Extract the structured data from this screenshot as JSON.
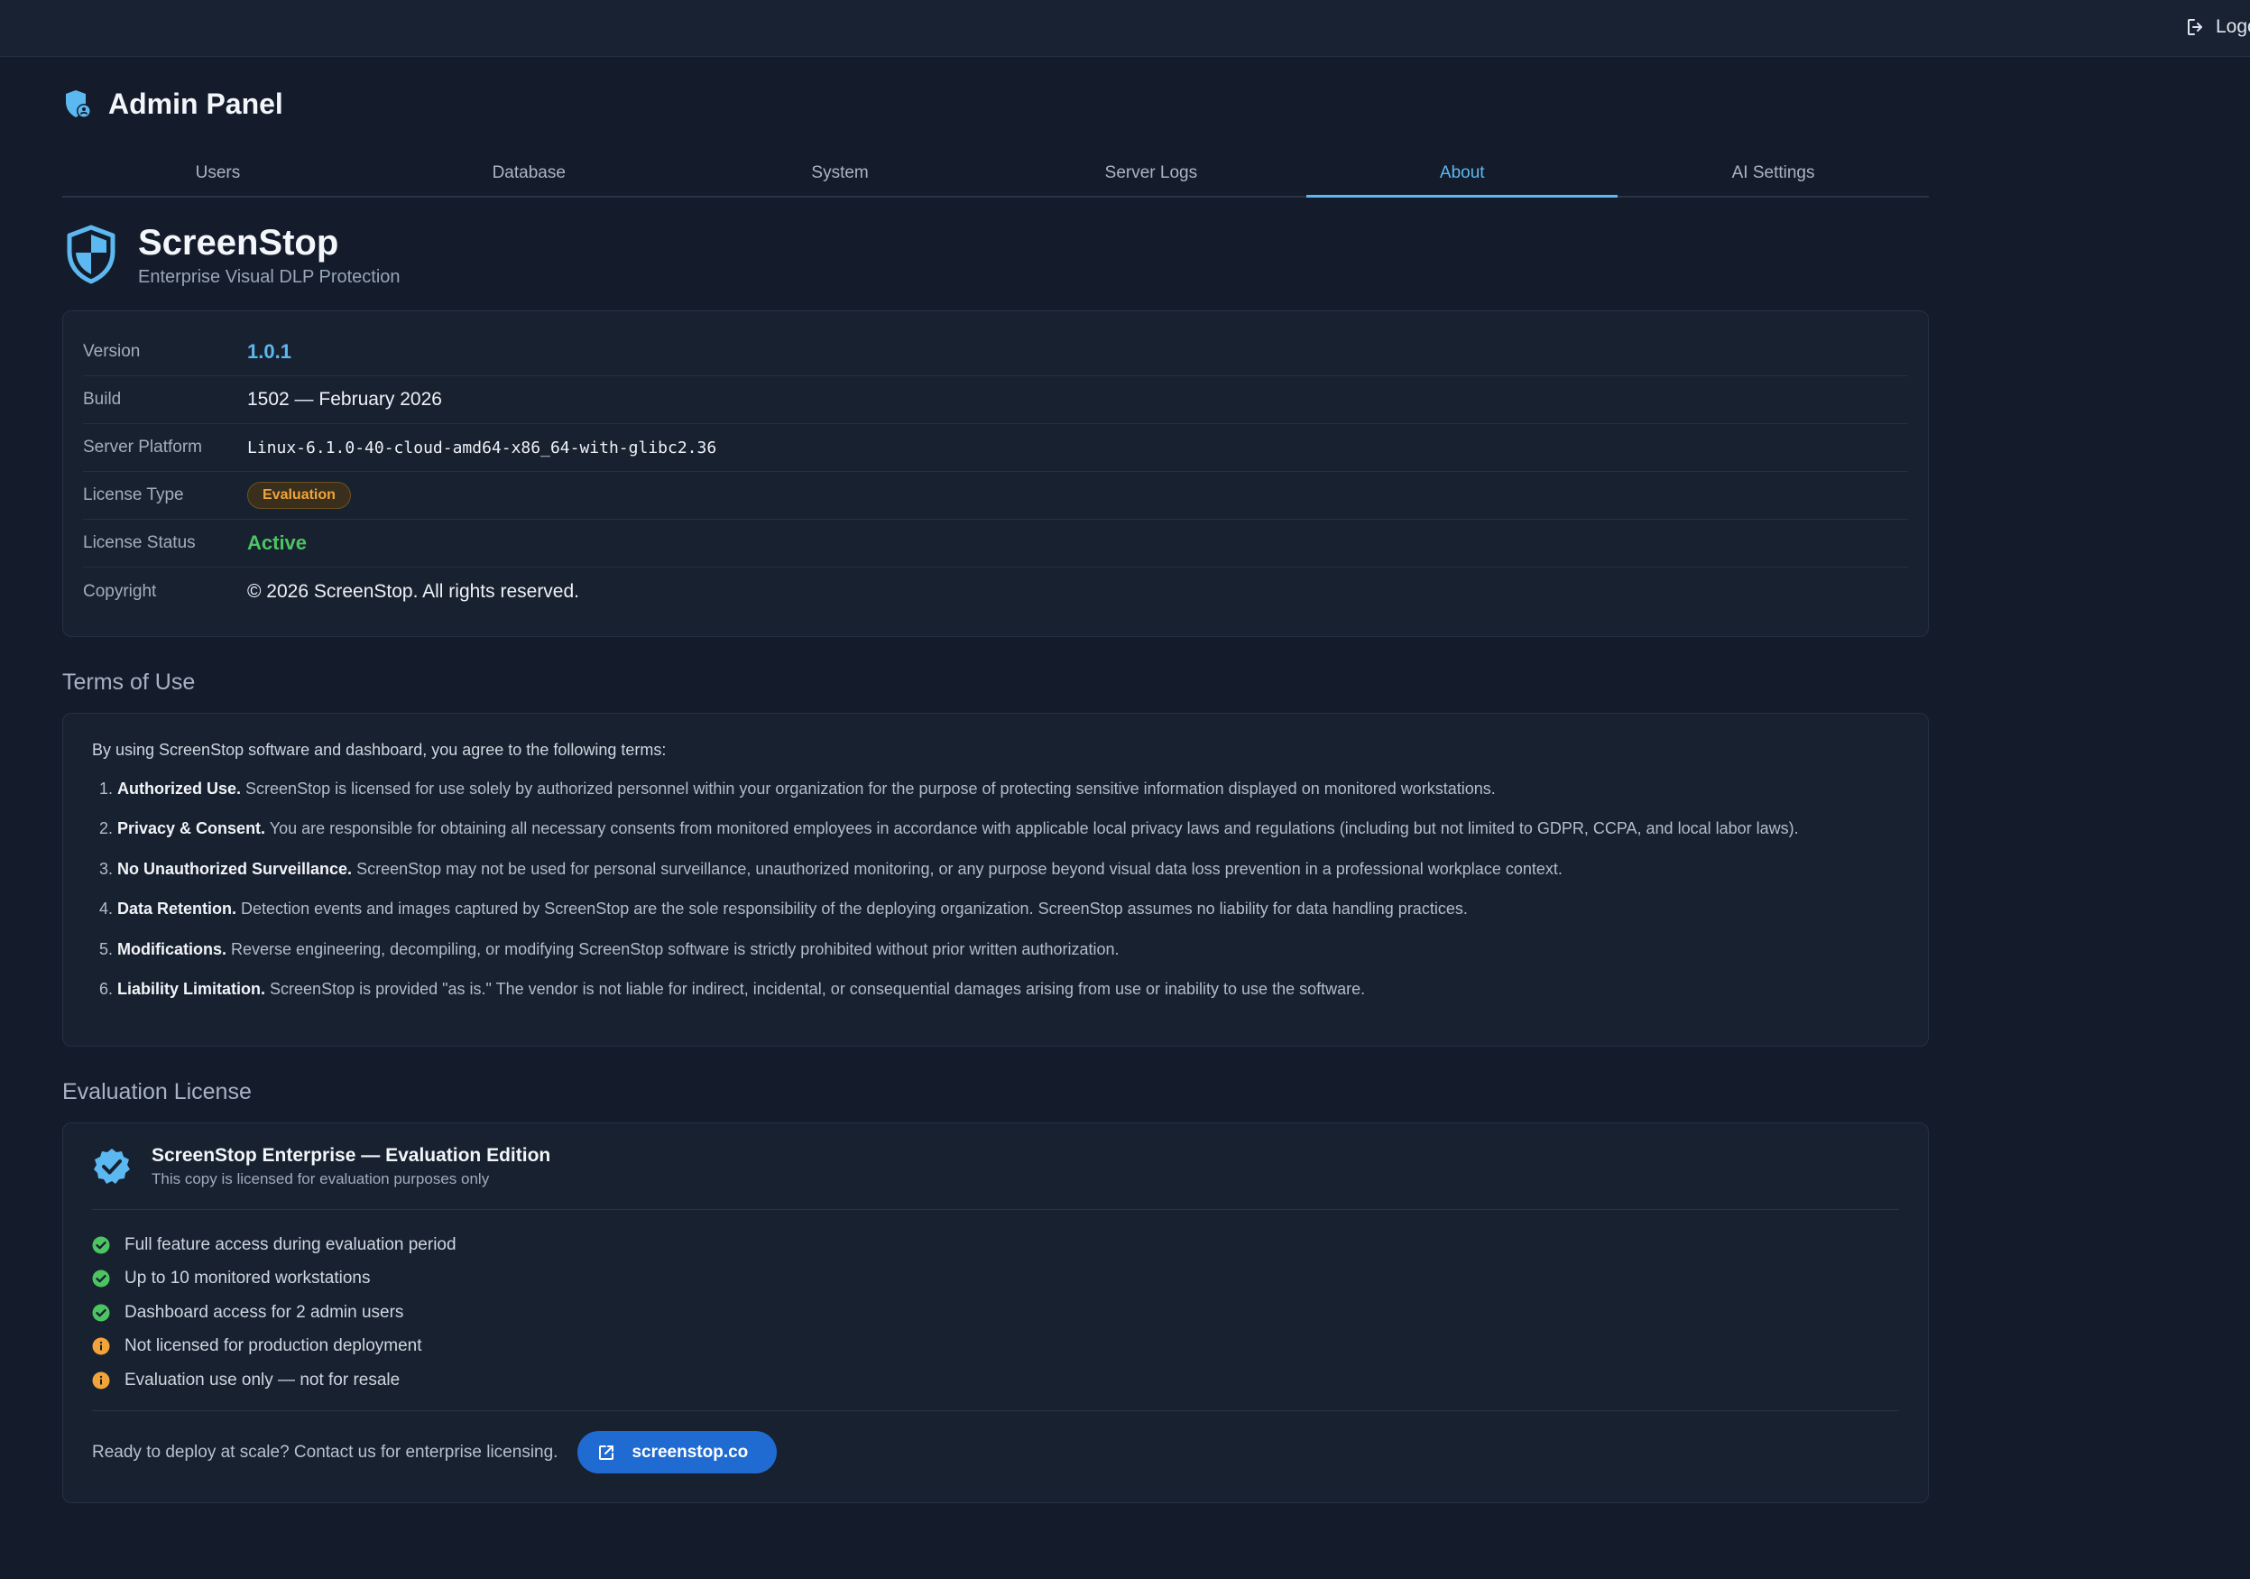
{
  "topbar": {
    "logout_label": "Logout",
    "logout_icon": "logout-icon"
  },
  "header": {
    "title": "Admin Panel",
    "icon": "shield-user-icon"
  },
  "tabs": [
    {
      "label": "Users",
      "active": false
    },
    {
      "label": "Database",
      "active": false
    },
    {
      "label": "System",
      "active": false
    },
    {
      "label": "Server Logs",
      "active": false
    },
    {
      "label": "About",
      "active": true
    },
    {
      "label": "AI Settings",
      "active": false
    }
  ],
  "brand": {
    "name": "ScreenStop",
    "tagline": "Enterprise Visual DLP Protection",
    "icon": "shield-icon"
  },
  "info": {
    "version_label": "Version",
    "version_value": "1.0.1",
    "build_label": "Build",
    "build_value": "1502 — February 2026",
    "platform_label": "Server Platform",
    "platform_value": "Linux-6.1.0-40-cloud-amd64-x86_64-with-glibc2.36",
    "license_type_label": "License Type",
    "license_type_value": "Evaluation",
    "license_status_label": "License Status",
    "license_status_value": "Active",
    "copyright_label": "Copyright",
    "copyright_value": "© 2026 ScreenStop. All rights reserved."
  },
  "terms": {
    "title": "Terms of Use",
    "intro": "By using ScreenStop software and dashboard, you agree to the following terms:",
    "items": [
      {
        "title": "Authorized Use.",
        "text": "ScreenStop is licensed for use solely by authorized personnel within your organization for the purpose of protecting sensitive information displayed on monitored workstations."
      },
      {
        "title": "Privacy & Consent.",
        "text": "You are responsible for obtaining all necessary consents from monitored employees in accordance with applicable local privacy laws and regulations (including but not limited to GDPR, CCPA, and local labor laws)."
      },
      {
        "title": "No Unauthorized Surveillance.",
        "text": "ScreenStop may not be used for personal surveillance, unauthorized monitoring, or any purpose beyond visual data loss prevention in a professional workplace context."
      },
      {
        "title": "Data Retention.",
        "text": "Detection events and images captured by ScreenStop are the sole responsibility of the deploying organization. ScreenStop assumes no liability for data handling practices."
      },
      {
        "title": "Modifications.",
        "text": "Reverse engineering, decompiling, or modifying ScreenStop software is strictly prohibited without prior written authorization."
      },
      {
        "title": "Liability Limitation.",
        "text": "ScreenStop is provided \"as is.\" The vendor is not liable for indirect, incidental, or consequential damages arising from use or inability to use the software."
      }
    ]
  },
  "evaluation": {
    "section_title": "Evaluation License",
    "heading": "ScreenStop Enterprise — Evaluation Edition",
    "subheading": "This copy is licensed for evaluation purposes only",
    "features": [
      {
        "text": "Full feature access during evaluation period",
        "icon": "check-circle-icon"
      },
      {
        "text": "Up to 10 monitored workstations",
        "icon": "check-circle-icon"
      },
      {
        "text": "Dashboard access for 2 admin users",
        "icon": "check-circle-icon"
      },
      {
        "text": "Not licensed for production deployment",
        "icon": "info-circle-icon"
      },
      {
        "text": "Evaluation use only — not for resale",
        "icon": "info-circle-icon"
      }
    ],
    "cta_text": "Ready to deploy at scale? Contact us for enterprise licensing.",
    "cta_button": "screenstop.co"
  },
  "colors": {
    "accent": "#5cb8f0",
    "success": "#4cc462",
    "warning": "#f0a43a",
    "button": "#1f6bd2",
    "background": "#141c2b",
    "card": "#18212f"
  }
}
